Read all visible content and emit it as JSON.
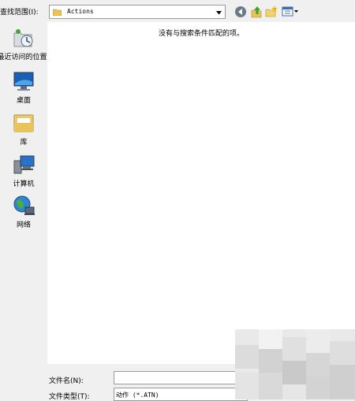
{
  "look_in": {
    "label": "查找范围(I):",
    "value": "Actions"
  },
  "places": [
    {
      "label": "最近访问的位置",
      "icon": "recent-places-icon"
    },
    {
      "label": "桌面",
      "icon": "desktop-icon"
    },
    {
      "label": "库",
      "icon": "libraries-icon"
    },
    {
      "label": "计算机",
      "icon": "computer-icon"
    },
    {
      "label": "网络",
      "icon": "network-icon"
    }
  ],
  "list": {
    "empty_message": "没有与搜索条件匹配的项。"
  },
  "file_name": {
    "label": "文件名(N):",
    "value": ""
  },
  "file_type": {
    "label": "文件类型(T):",
    "value": "动作 (*.ATN)"
  },
  "colors": {
    "window_bg": "#f0f0f0",
    "list_bg": "#ffffff"
  }
}
